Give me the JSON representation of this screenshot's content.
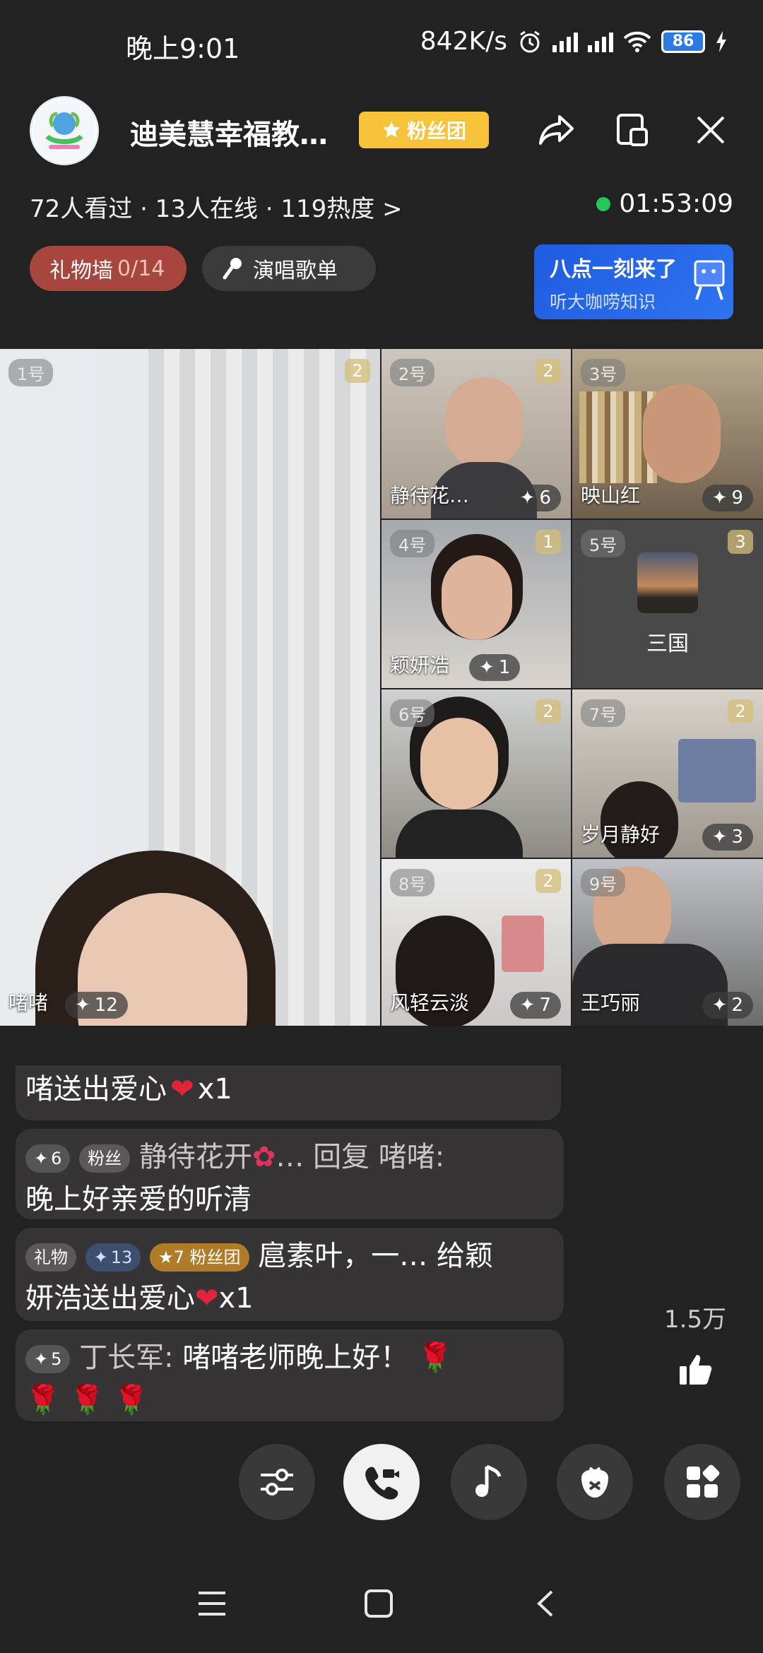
{
  "status": {
    "time": "晚上9:01",
    "net_speed": "842K/s",
    "battery": "86"
  },
  "header": {
    "room_title": "迪美慧幸福教…",
    "fans_button": "粉丝团",
    "stats": "72人看过 · 13人在线 · 119热度 >",
    "timer": "01:53:09",
    "gift_wall_label": "礼物墙",
    "gift_wall_count": "0/14",
    "song_list": "演唱歌单",
    "promo_line1": "八点一刻来了",
    "promo_line2": "听大咖唠知识"
  },
  "tiles": [
    {
      "num": "1号",
      "badge": "2",
      "name": "啫啫",
      "score": "12"
    },
    {
      "num": "2号",
      "badge": "2",
      "name": "静待花…",
      "score": "6"
    },
    {
      "num": "3号",
      "badge": "",
      "name": "映山红",
      "score": "9"
    },
    {
      "num": "4号",
      "badge": "1",
      "name": "颖妍浩",
      "score": "1"
    },
    {
      "num": "5号",
      "badge": "3",
      "name": "三国",
      "score": ""
    },
    {
      "num": "6号",
      "badge": "2",
      "name": "",
      "score": ""
    },
    {
      "num": "7号",
      "badge": "2",
      "name": "岁月静好",
      "score": "3"
    },
    {
      "num": "8号",
      "badge": "2",
      "name": "风轻云淡",
      "score": "7"
    },
    {
      "num": "9号",
      "badge": "",
      "name": "王巧丽",
      "score": "2"
    }
  ],
  "chat": [
    {
      "text": "啫送出爱心",
      "suffix": "x1"
    },
    {
      "level": "6",
      "tag": "粉丝",
      "user": "静待花开",
      "ellipsis": "…",
      "action": "回复 啫啫:",
      "text": "晚上好亲爱的听清"
    },
    {
      "tag": "礼物",
      "level": "13",
      "fans_level": "7",
      "fans_tag": "粉丝团",
      "user": "扈素叶，一…",
      "action": "给颖",
      "text": "妍浩送出爱心",
      "suffix": "x1"
    },
    {
      "level": "5",
      "user": "丁长军:",
      "text": "啫啫老师晚上好！"
    }
  ],
  "likes": "1.5万",
  "colors": {
    "accent_gold": "#f6c33a",
    "gift_wall": "#a6463f",
    "promo_blue": "#2e74f0",
    "live_green": "#21c75a"
  }
}
